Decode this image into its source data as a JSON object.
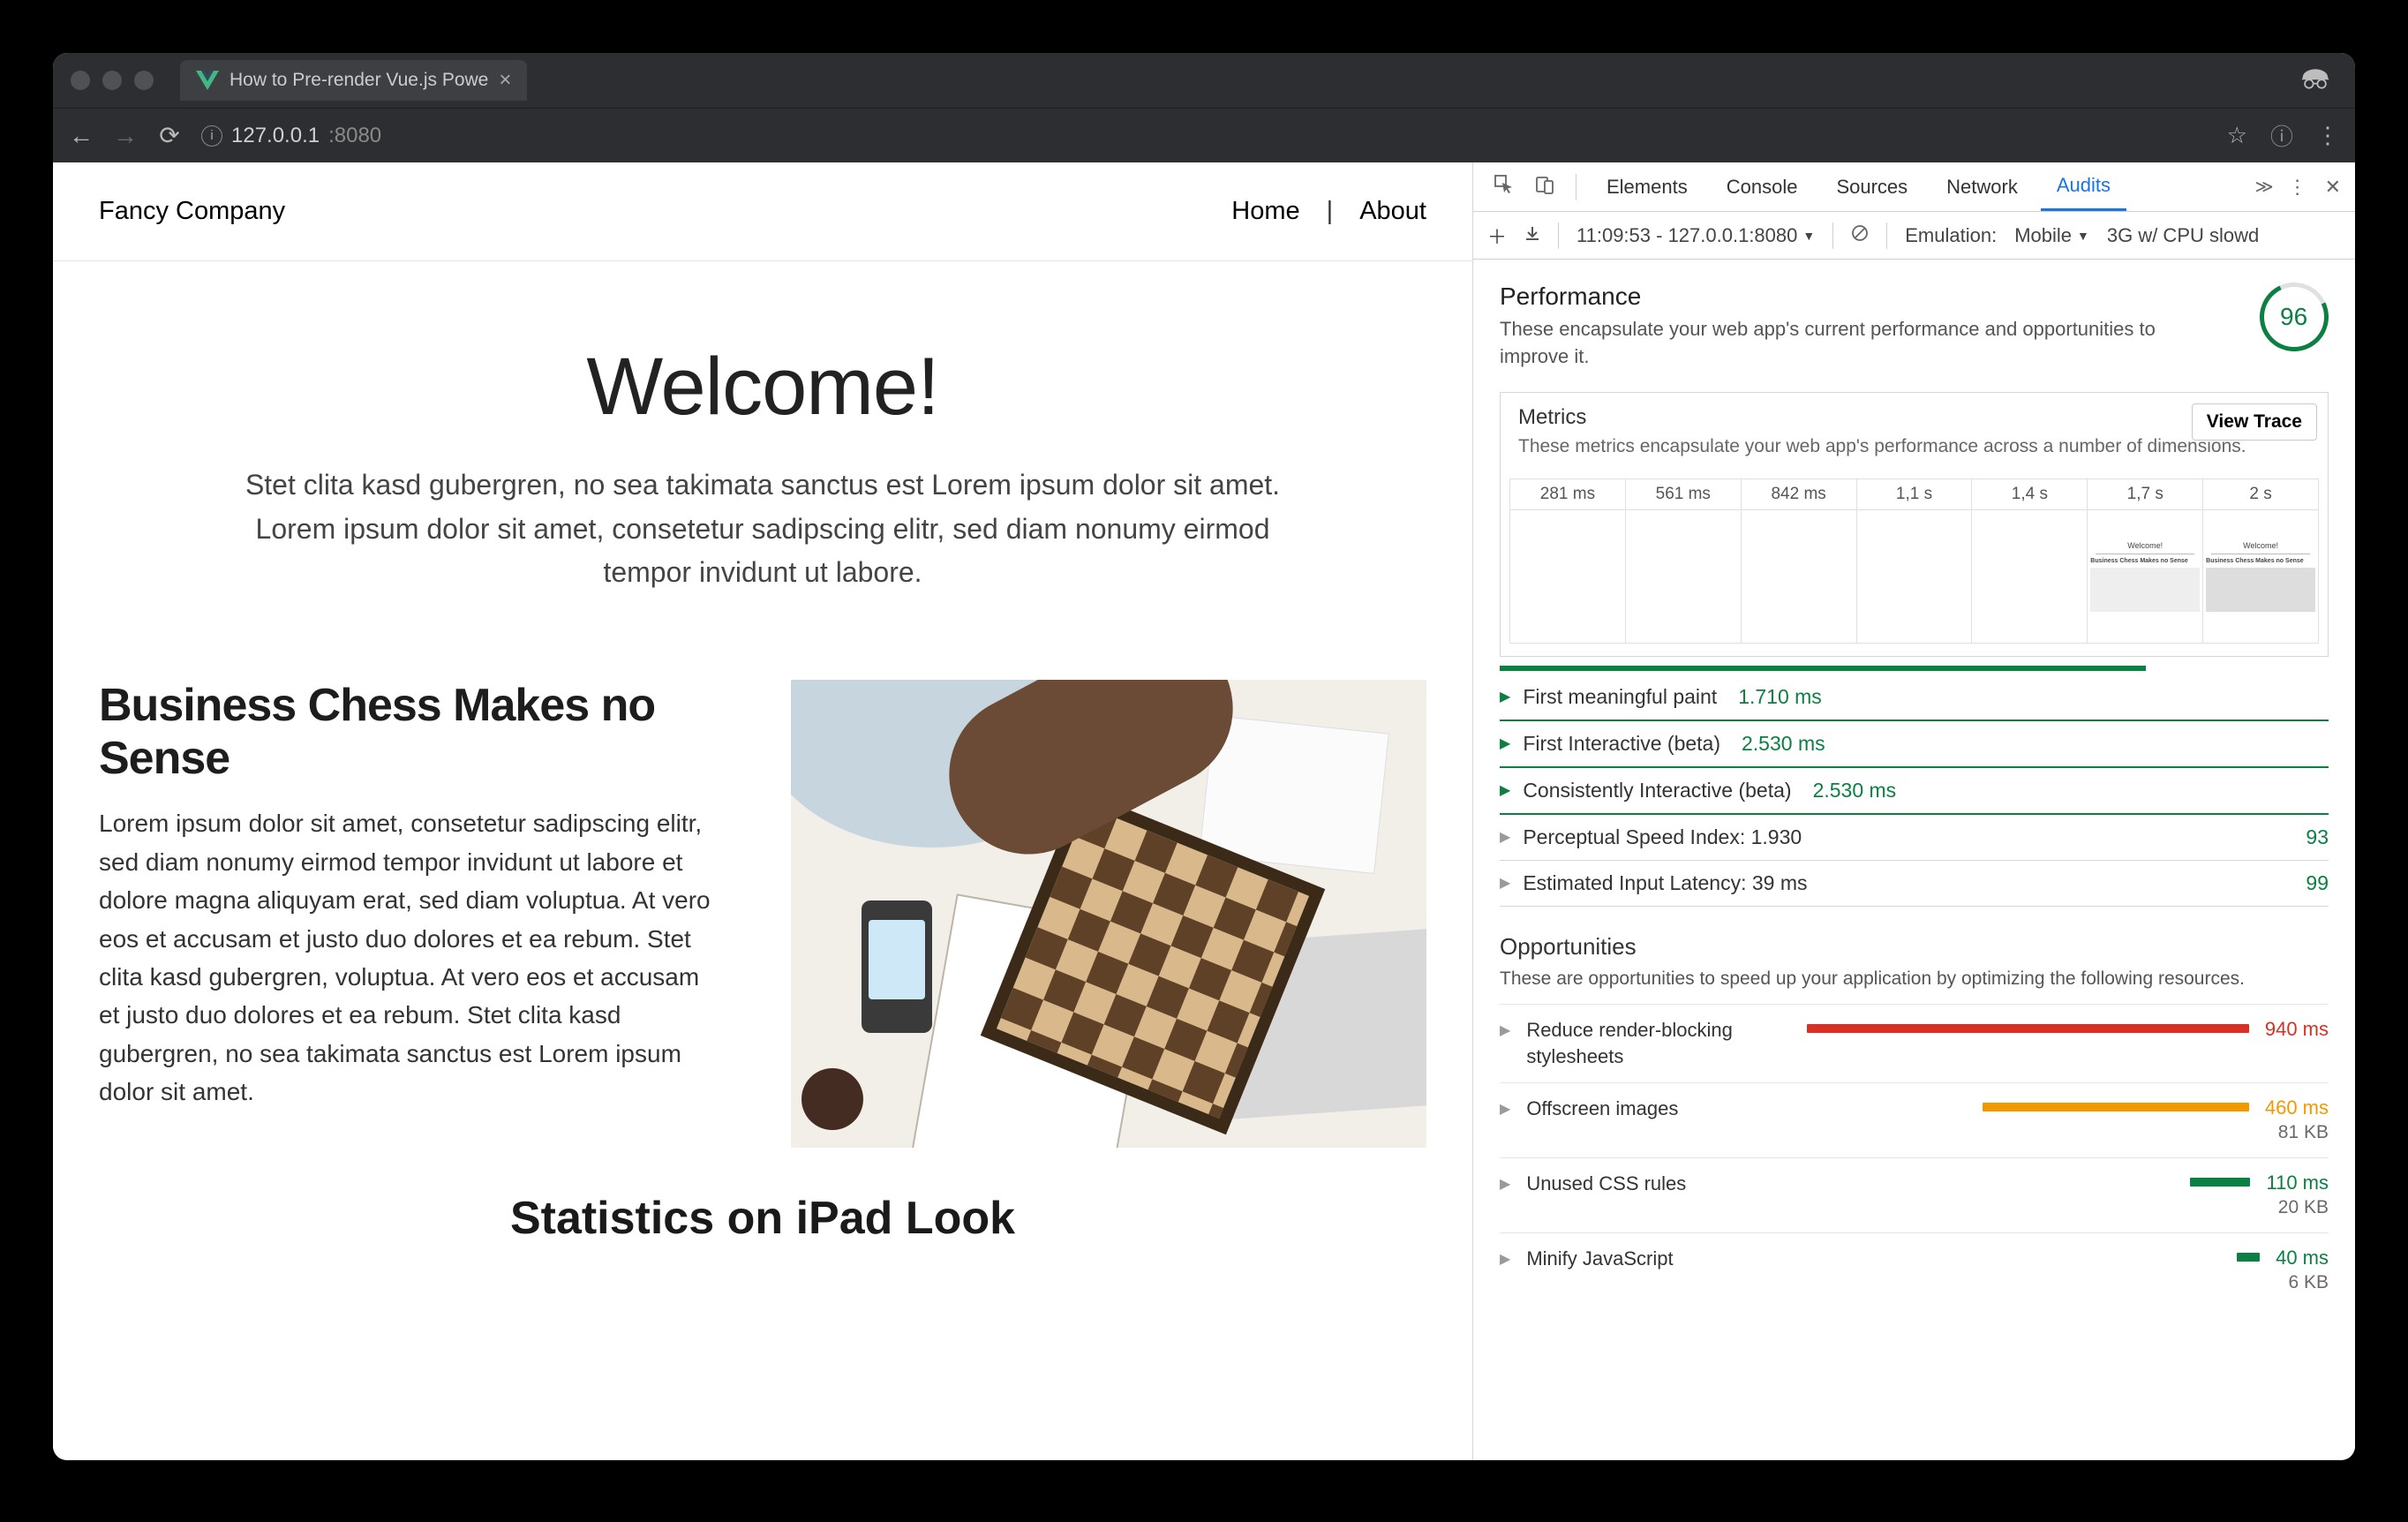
{
  "browser": {
    "tab_title": "How to Pre-render Vue.js Powe",
    "address_host": "127.0.0.1",
    "address_port": ":8080"
  },
  "site": {
    "brand": "Fancy Company",
    "nav_home": "Home",
    "nav_sep": "|",
    "nav_about": "About",
    "hero_h1": "Welcome!",
    "hero_p": "Stet clita kasd gubergren, no sea takimata sanctus est Lorem ipsum dolor sit amet. Lorem ipsum dolor sit amet, consetetur sadipscing elitr, sed diam nonumy eirmod tempor invidunt ut labore.",
    "article_h2": "Business Chess Makes no Sense",
    "article_p": "Lorem ipsum dolor sit amet, consetetur sadipscing elitr, sed diam nonumy eirmod tempor invidunt ut labore et dolore magna aliquyam erat, sed diam voluptua. At vero eos et accusam et justo duo dolores et ea rebum. Stet clita kasd gubergren, voluptua. At vero eos et accusam et justo duo dolores et ea rebum. Stet clita kasd gubergren, no sea takimata sanctus est Lorem ipsum dolor sit amet.",
    "teaser_h2": "Statistics on iPad Look"
  },
  "devtools": {
    "panels": {
      "p0": "Elements",
      "p1": "Console",
      "p2": "Sources",
      "p3": "Network",
      "p4": "Audits"
    },
    "subbar": {
      "run_time": "11:09:53 - 127.0.0.1:8080",
      "emulation_label": "Emulation:",
      "emulation_value": "Mobile",
      "network_value": "3G w/ CPU slowd"
    },
    "perf": {
      "heading": "Performance",
      "desc": "These encapsulate your web app's current performance and opportunities to improve it.",
      "score": "96",
      "metrics_heading": "Metrics",
      "metrics_desc": "These metrics encapsulate your web app's performance across a number of dimensions.",
      "view_trace": "View Trace",
      "filmstrip": {
        "t0": "281 ms",
        "t1": "561 ms",
        "t2": "842 ms",
        "t3": "1,1 s",
        "t4": "1,4 s",
        "t5": "1,7 s",
        "t6": "2 s"
      },
      "mini_h": "Welcome!",
      "mini_sub": "Business Chess Makes no Sense",
      "metrics": {
        "m0": {
          "label": "First meaningful paint",
          "value": "1.710 ms"
        },
        "m1": {
          "label": "First Interactive (beta)",
          "value": "2.530 ms"
        },
        "m2": {
          "label": "Consistently Interactive (beta)",
          "value": "2.530 ms"
        },
        "m3": {
          "label": "Perceptual Speed Index: 1.930",
          "score": "93"
        },
        "m4": {
          "label": "Estimated Input Latency: 39 ms",
          "score": "99"
        }
      },
      "opps_heading": "Opportunities",
      "opps_desc": "These are opportunities to speed up your application by optimizing the following resources.",
      "opps": {
        "o0": {
          "label": "Reduce render-blocking stylesheets",
          "v1": "940 ms",
          "color": "red",
          "bar_color": "#d93025",
          "bar_w": "100%"
        },
        "o1": {
          "label": "Offscreen images",
          "v1": "460 ms",
          "v2": "81 KB",
          "color": "orange",
          "bar_color": "#f29900",
          "bar_w": "48%",
          "bar_ml": "52%"
        },
        "o2": {
          "label": "Unused CSS rules",
          "v1": "110 ms",
          "v2": "20 KB",
          "color": "green",
          "bar_color": "#0b8043",
          "bar_w": "11%",
          "bar_ml": "89%"
        },
        "o3": {
          "label": "Minify JavaScript",
          "v1": "40 ms",
          "v2": "6 KB",
          "color": "green",
          "bar_color": "#0b8043",
          "bar_w": "4%",
          "bar_ml": "96%"
        }
      }
    }
  }
}
